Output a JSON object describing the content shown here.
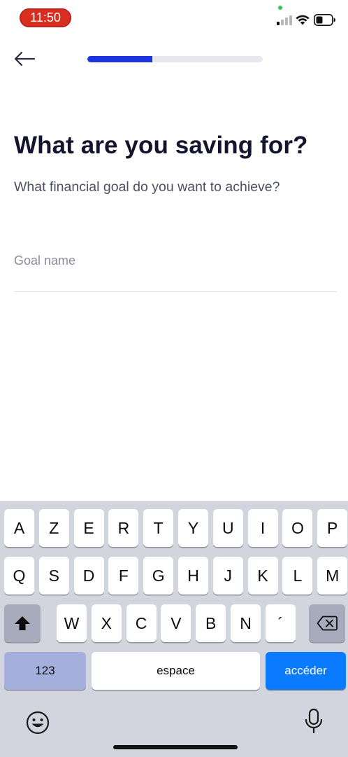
{
  "status_bar": {
    "time": "11:50",
    "icons": [
      "signal-icon",
      "wifi-icon",
      "battery-icon"
    ]
  },
  "header": {
    "back_icon": "arrow-left-icon",
    "progress": 0.37
  },
  "content": {
    "title": "What are you saving for?",
    "subtitle": "What financial goal do you want to achieve?",
    "goal_field": {
      "value": "",
      "placeholder": "Goal name"
    }
  },
  "keyboard": {
    "row1": [
      "A",
      "Z",
      "E",
      "R",
      "T",
      "Y",
      "U",
      "I",
      "O",
      "P"
    ],
    "row2": [
      "Q",
      "S",
      "D",
      "F",
      "G",
      "H",
      "J",
      "K",
      "L",
      "M"
    ],
    "row3": [
      "W",
      "X",
      "C",
      "V",
      "B",
      "N",
      "´"
    ],
    "numbers_label": "123",
    "space_label": "espace",
    "return_label": "accéder",
    "shift_icon": "shift-icon",
    "delete_icon": "backspace-icon",
    "emoji_icon": "emoji-icon",
    "mic_icon": "microphone-icon"
  },
  "colors": {
    "accent": "#1d33e0",
    "time_pill": "#d92d20",
    "return_key": "#0a7aff",
    "title_text": "#14142e"
  }
}
